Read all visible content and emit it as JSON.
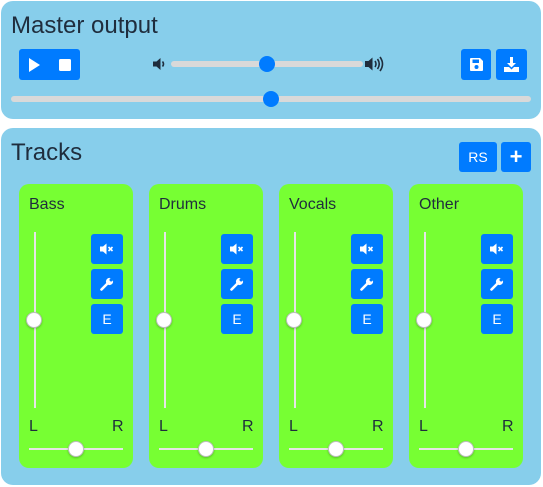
{
  "master": {
    "title": "Master output",
    "volume_level": 0.5,
    "position_level": 0.5,
    "buttons": {
      "play_icon": "play-icon",
      "stop_icon": "stop-icon",
      "save_icon": "save-icon",
      "download_icon": "download-icon",
      "volume_low_icon": "volume-low-icon",
      "volume_high_icon": "volume-high-icon"
    }
  },
  "tracks_panel": {
    "title": "Tracks",
    "rs_label": "RS",
    "add_label": "+"
  },
  "tracks": [
    {
      "name": "Bass",
      "left_label": "L",
      "right_label": "R",
      "volume_level": 0.5,
      "pan_level": 0.5,
      "edit_label": "E"
    },
    {
      "name": "Drums",
      "left_label": "L",
      "right_label": "R",
      "volume_level": 0.5,
      "pan_level": 0.5,
      "edit_label": "E"
    },
    {
      "name": "Vocals",
      "left_label": "L",
      "right_label": "R",
      "volume_level": 0.5,
      "pan_level": 0.5,
      "edit_label": "E"
    },
    {
      "name": "Other",
      "left_label": "L",
      "right_label": "R",
      "volume_level": 0.5,
      "pan_level": 0.5,
      "edit_label": "E"
    }
  ],
  "colors": {
    "panel": "#87ceeb",
    "card": "#77ff33",
    "accent": "#007bff"
  }
}
